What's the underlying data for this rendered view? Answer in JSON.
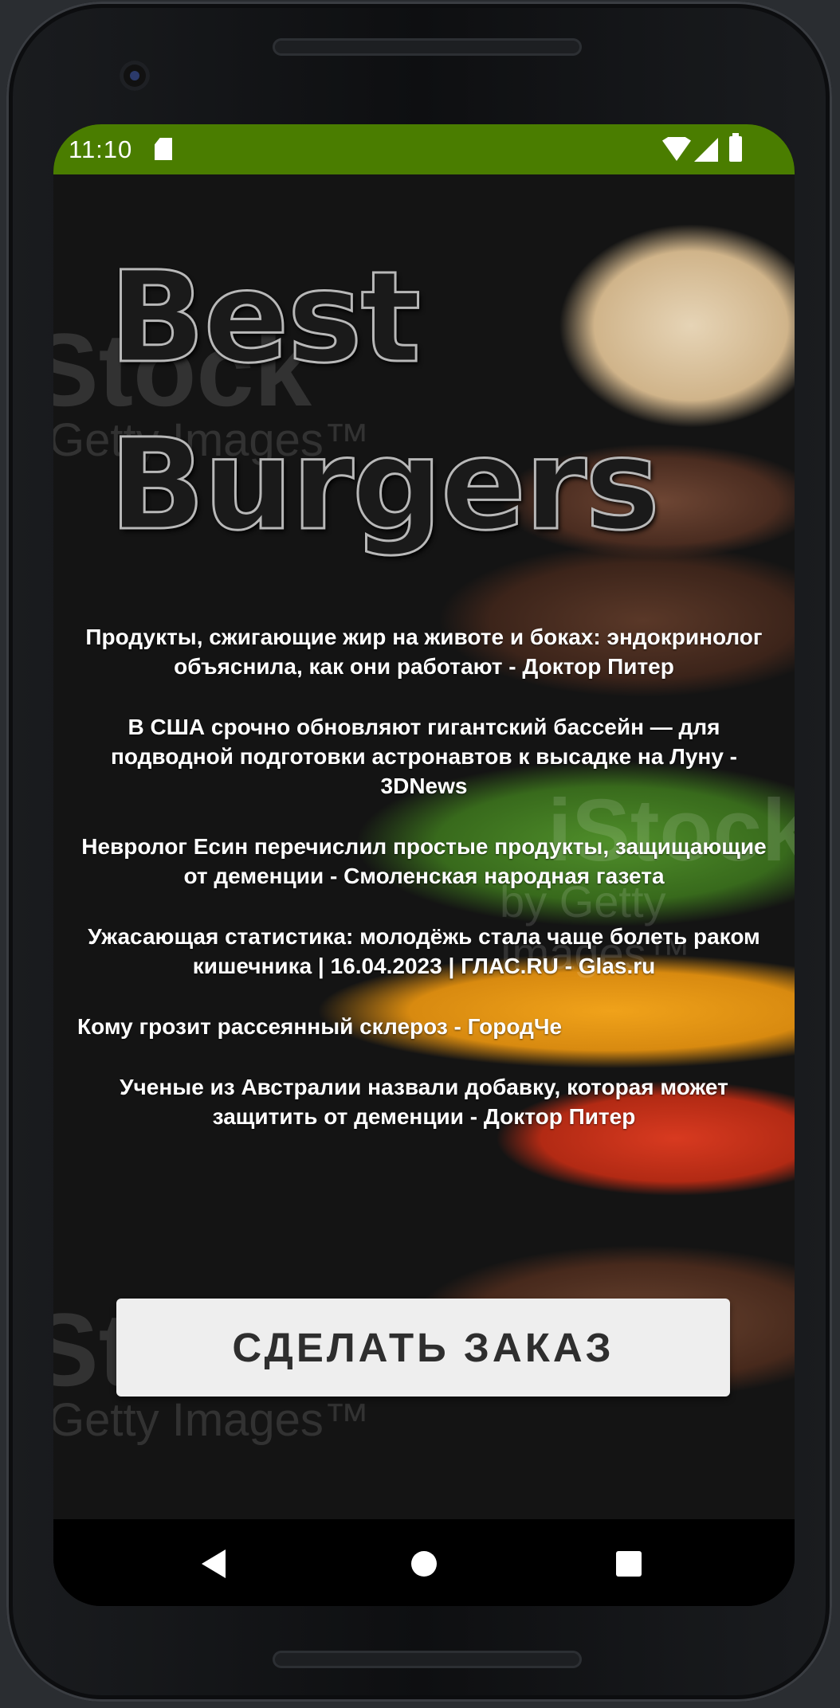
{
  "status_bar": {
    "time": "11:10",
    "color": "#4a7d00",
    "icons": [
      "sd-card-icon",
      "wifi-icon",
      "cell-signal-icon",
      "battery-icon"
    ]
  },
  "app": {
    "title": "Best\nBurgers",
    "news": [
      "Продукты, сжигающие жир на животе и боках: эндокринолог объяснила, как они работают - Доктор Питер",
      "В США срочно обновляют гигантский бассейн — для подводной подготовки астронавтов к высадке на Луну - 3DNews",
      "Невролог Есин перечислил простые продукты, защищающие от деменции - Смоленская народная газета",
      "Ужасающая статистика: молодёжь стала чаще болеть раком кишечника | 16.04.2023 | ГЛАС.RU - Glas.ru",
      "Кому грозит рассеянный склероз - ГородЧе",
      "Ученые из Австралии назвали добавку, которая может защитить от деменции - Доктор Питер"
    ],
    "order_button_label": "СДЕЛАТЬ ЗАКАЗ",
    "background_watermark": [
      "Stock",
      "Getty Images™",
      "Stock",
      "Getty Images™",
      "iStock",
      "by Getty Images™"
    ]
  },
  "nav_bar": {
    "buttons": [
      "back-icon",
      "home-icon",
      "recent-apps-icon"
    ]
  }
}
